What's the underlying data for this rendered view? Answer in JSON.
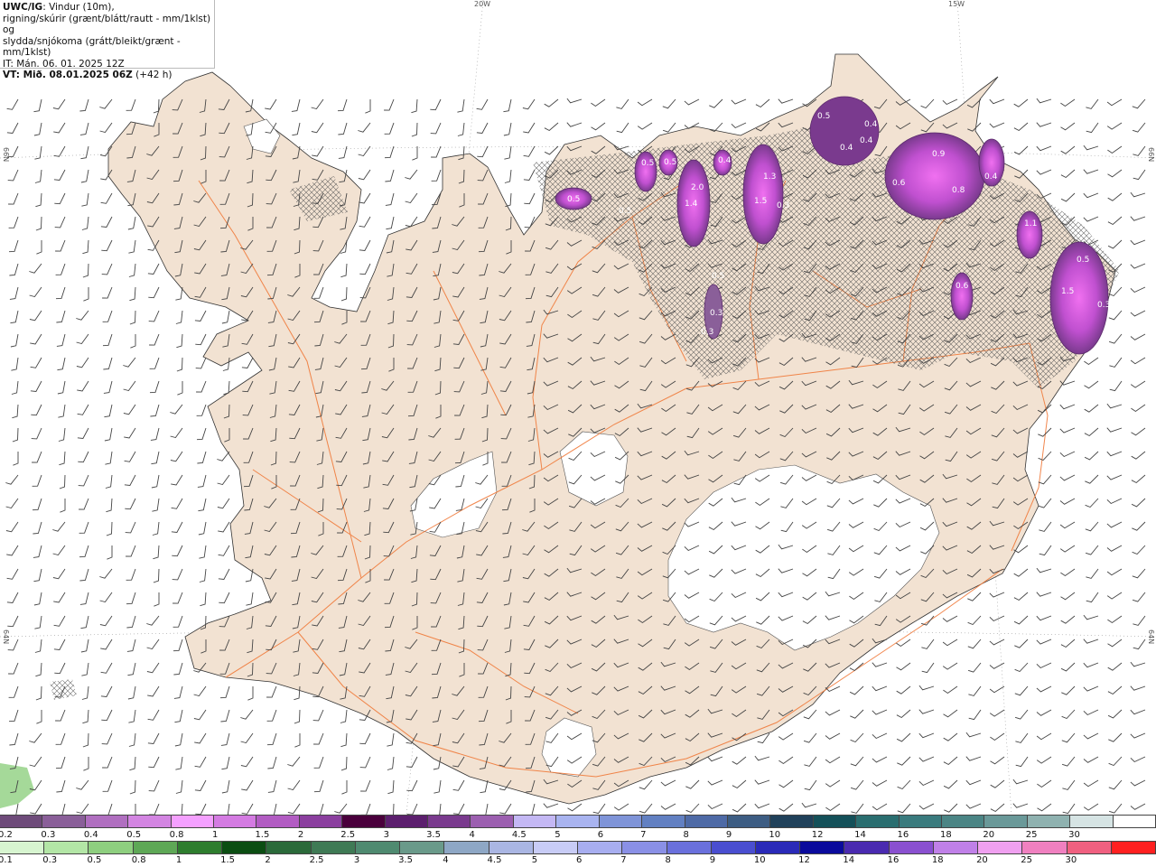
{
  "title": {
    "brand": "UWC/IG",
    "line1": ": Vindur (10m),",
    "line2": "rigning/skúrir (grænt/blátt/rautt - mm/1klst) og",
    "line3": "slydda/snjókoma (grátt/bleikt/grænt - mm/1klst)",
    "it_line": "IT: Mán. 06. 01. 2025 12Z",
    "vt_prefix": "VT: Mið. 08.01.2025 06Z",
    "vt_suffix": " (+42 h)"
  },
  "grid_labels": {
    "lon_20w": "20W",
    "lon_15w": "15W",
    "lat_66n_left": "66N",
    "lat_66n_right": "66N",
    "lat_64n_left": "64N",
    "lat_64n_right": "64N"
  },
  "precip_labels": [
    "0.5",
    "0.4",
    "0.4",
    "0.4",
    "0.5",
    "0.5",
    "0.5",
    "0.4",
    "2.0",
    "1.4",
    "1.3",
    "1.5",
    "0.3",
    "0.5",
    "0.9",
    "0.6",
    "0.8",
    "0.4",
    "1.1",
    "0.5",
    "0.3",
    "0.3",
    "0.6",
    "1.5",
    "0.3",
    "0.5"
  ],
  "legend_snow": {
    "labels": [
      "0.2",
      "0.3",
      "0.4",
      "0.5",
      "0.8",
      "1",
      "1.5",
      "2",
      "2.5",
      "3",
      "3.5",
      "4",
      "4.5",
      "5",
      "6",
      "7",
      "8",
      "9",
      "10",
      "12",
      "14",
      "16",
      "18",
      "20",
      "25",
      "30"
    ],
    "colors": [
      "#6e4b7a",
      "#8a5f99",
      "#b06fc0",
      "#d385e2",
      "#f4a0ff",
      "#d47be2",
      "#b25cc3",
      "#8b3f9f",
      "#4a003c",
      "#5c1f6e",
      "#7a3a8e",
      "#9c5fb0",
      "#c4b8f4",
      "#a9b4f0",
      "#7f94d8",
      "#6280c2",
      "#4e6aa6",
      "#3d5d83",
      "#20415a",
      "#145059",
      "#2a6e70",
      "#3a7b7e",
      "#4b8585",
      "#6a9999",
      "#8fb2b0",
      "#d6e4e4",
      "#ffffff"
    ]
  },
  "legend_rain": {
    "labels": [
      "0.1",
      "0.3",
      "0.5",
      "0.8",
      "1",
      "1.5",
      "2",
      "2.5",
      "3",
      "3.5",
      "4",
      "4.5",
      "5",
      "6",
      "7",
      "8",
      "9",
      "10",
      "12",
      "14",
      "16",
      "18",
      "20",
      "25",
      "30"
    ],
    "colors": [
      "#d7f5d0",
      "#b3e6a6",
      "#8ecf7f",
      "#5ea856",
      "#2e7d2e",
      "#0b4d12",
      "#2b6a3a",
      "#3f7a55",
      "#4f8a70",
      "#6a9a8a",
      "#8ea7c5",
      "#aab6e3",
      "#c8ccf6",
      "#a8aef0",
      "#8a90e6",
      "#6a70dc",
      "#4a4ed0",
      "#2a2ab8",
      "#0a0a9c",
      "#4a2ab0",
      "#8a50d0",
      "#c080e8",
      "#f0a0f0",
      "#f080c0",
      "#f06080",
      "#ff2020"
    ]
  }
}
